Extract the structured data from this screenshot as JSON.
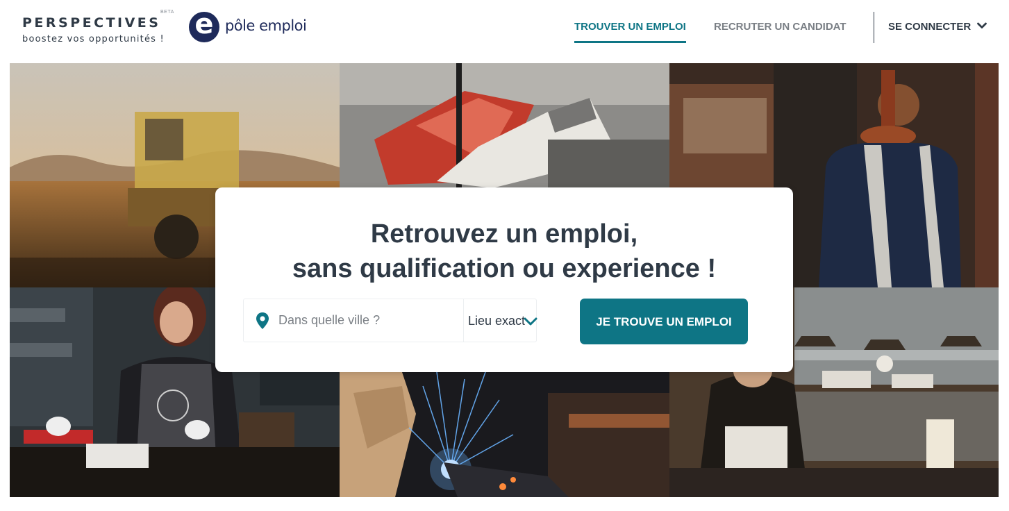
{
  "header": {
    "brand_title": "PERSPECTIVES",
    "brand_beta": "BETA",
    "brand_tagline": "boostez vos opportunités !",
    "partner_logo_letter": "e",
    "partner_logo_text": "pôle emploi",
    "nav": {
      "find_job": "TROUVER UN EMPLOI",
      "recruit": "RECRUTER UN CANDIDAT",
      "connect": "SE CONNECTER"
    }
  },
  "hero": {
    "tiles": [
      "farm-harvester-photo",
      "gloved-hand-tool-photo",
      "tailor-mannequin-photo",
      "cook-woman-photo",
      "welder-sparks-photo",
      "restaurant-kitchen-photo"
    ]
  },
  "search": {
    "title_line1": "Retrouvez un emploi,",
    "title_line2": "sans qualification ou experience !",
    "city_placeholder": "Dans quelle ville ?",
    "city_value": "",
    "location_mode": "Lieu exact",
    "submit_label": "JE TROUVE UN EMPLOI"
  },
  "colors": {
    "accent": "#0e7585",
    "text_dark": "#2f3a46",
    "text_muted": "#7a7f85",
    "partner_navy": "#1e2a5a"
  },
  "icons": {
    "location": "map-pin-icon",
    "dropdown": "chevron-down-icon"
  }
}
